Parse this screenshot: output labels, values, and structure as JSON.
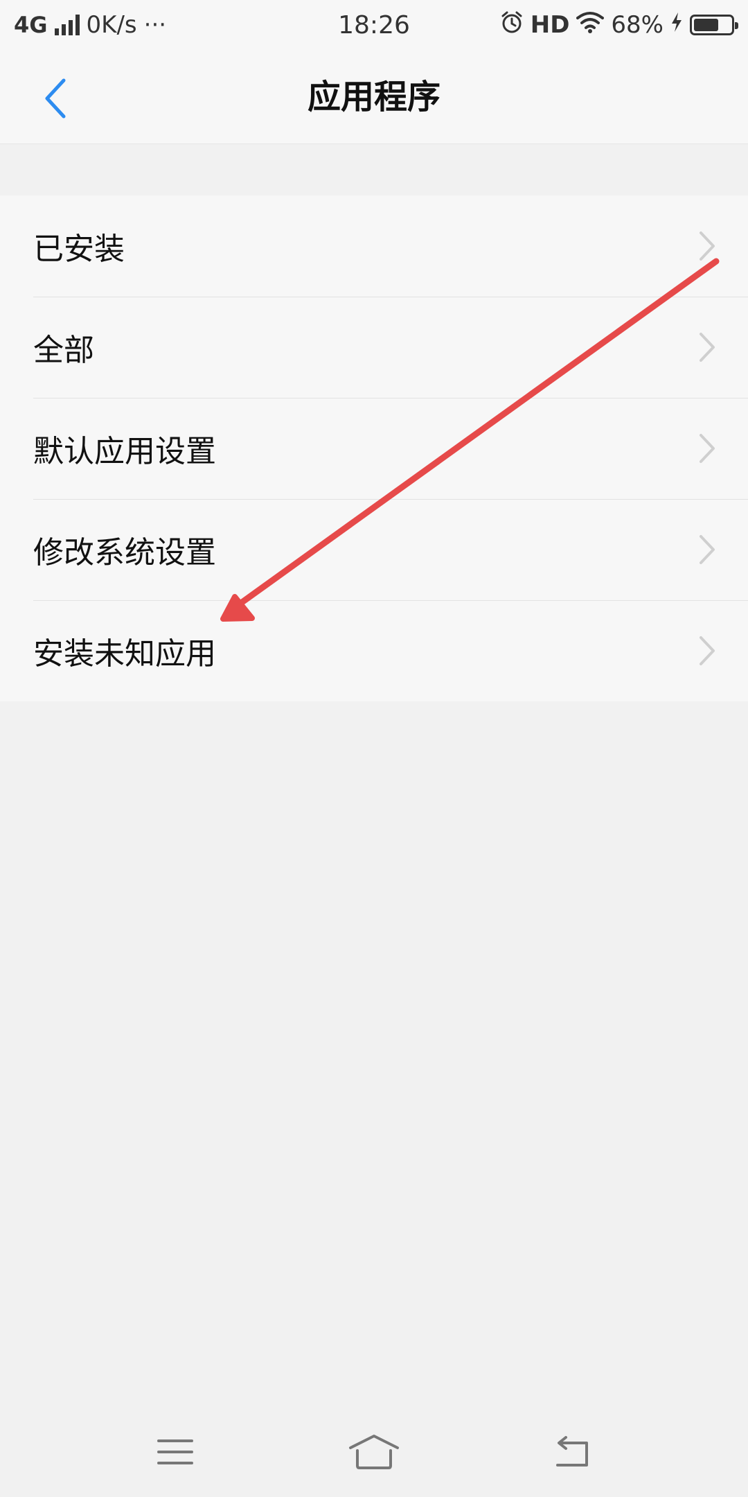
{
  "status_bar": {
    "network": "4G",
    "speed": "0K/s",
    "more": "···",
    "time": "18:26",
    "hd": "HD",
    "battery_percent": "68%",
    "battery_level": 0.68,
    "icons": [
      "signal-icon",
      "alarm-icon",
      "wifi-icon",
      "charging-icon",
      "battery-icon"
    ]
  },
  "header": {
    "title": "应用程序",
    "back_icon": "chevron-left-icon"
  },
  "list": {
    "items": [
      {
        "label": "已安装"
      },
      {
        "label": "全部"
      },
      {
        "label": "默认应用设置"
      },
      {
        "label": "修改系统设置"
      },
      {
        "label": "安装未知应用"
      }
    ]
  },
  "annotation": {
    "color": "#e64a4a",
    "description_target": "安装未知应用"
  },
  "nav_bar": {
    "icons": [
      "menu-icon",
      "home-icon",
      "back-icon"
    ]
  },
  "colors": {
    "accent": "#2d8cf0",
    "background": "#f1f1f1",
    "surface": "#f7f7f7"
  }
}
